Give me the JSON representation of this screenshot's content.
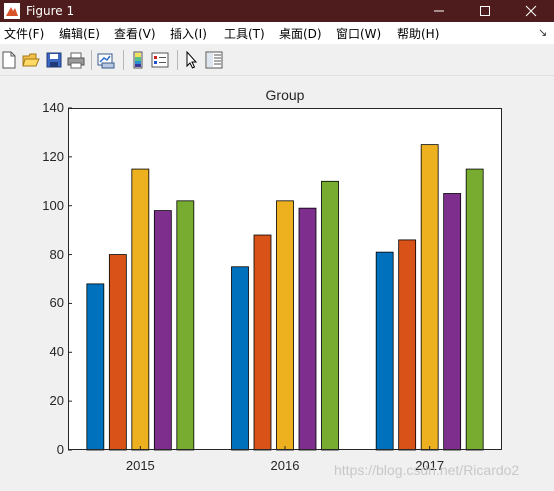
{
  "window": {
    "title": "Figure 1"
  },
  "menu": [
    "文件(F)",
    "编辑(E)",
    "查看(V)",
    "插入(I)",
    "工具(T)",
    "桌面(D)",
    "窗口(W)",
    "帮助(H)"
  ],
  "toolbar": {
    "icons": [
      "new-figure-icon",
      "open-file-icon",
      "save-icon",
      "print-icon",
      "link-plot-icon",
      "colorbar-icon",
      "legend-icon",
      "pointer-icon",
      "property-inspector-icon"
    ]
  },
  "chart_data": {
    "type": "bar",
    "title": "Group",
    "categories": [
      "2015",
      "2016",
      "2017"
    ],
    "series": [
      {
        "color": "#0072bd",
        "values": [
          68,
          75,
          81
        ]
      },
      {
        "color": "#d95319",
        "values": [
          80,
          88,
          86
        ]
      },
      {
        "color": "#edb120",
        "values": [
          115,
          102,
          125
        ]
      },
      {
        "color": "#7e2f8e",
        "values": [
          98,
          99,
          105
        ]
      },
      {
        "color": "#77ac30",
        "values": [
          102,
          110,
          115
        ]
      }
    ],
    "ylim": [
      0,
      140
    ],
    "yticks": [
      "0",
      "20",
      "40",
      "60",
      "80",
      "100",
      "120",
      "140"
    ],
    "grid": false
  },
  "watermark": "https://blog.csdn.net/Ricardo2"
}
